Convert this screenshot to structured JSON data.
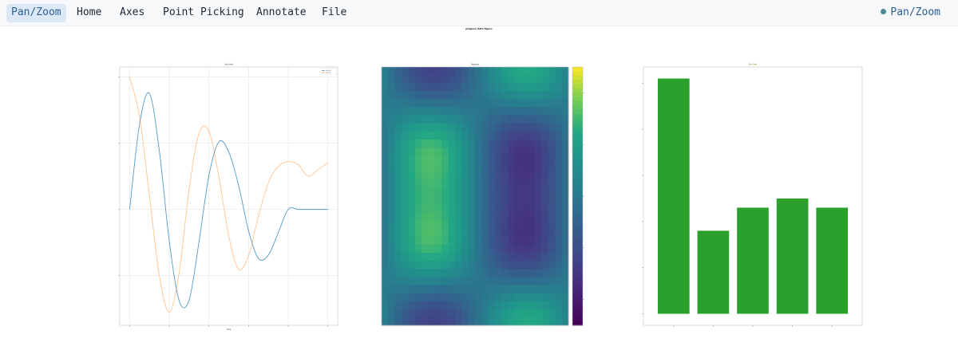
{
  "toolbar": {
    "buttons": [
      {
        "label": "Pan/Zoom",
        "active": true
      },
      {
        "label": "Home",
        "active": false
      },
      {
        "label": "Axes",
        "active": false
      },
      {
        "label": "Point Picking",
        "active": false
      },
      {
        "label": "Annotate",
        "active": false
      },
      {
        "label": "File",
        "active": false
      }
    ],
    "mode_label": "Pan/Zoom"
  },
  "figure": {
    "suptitle": "pidgeon data figure"
  },
  "chart_data": [
    {
      "type": "line",
      "title": "Line chart",
      "xlabel": "Time",
      "ylabel": "",
      "grid": true,
      "legend_placement": "top-right",
      "legend": [
        "Series A",
        "Series B"
      ],
      "xlim": [
        -0.5,
        10.5
      ],
      "ylim": [
        -1.75,
        2.15
      ],
      "series": [
        {
          "name": "Series A",
          "color": "#1f77b4",
          "x": [
            0,
            0.5,
            1,
            1.5,
            2,
            2.5,
            3,
            3.5,
            4,
            4.5,
            5,
            5.5,
            6,
            6.5,
            7,
            7.5,
            8,
            8.5,
            9,
            9.5,
            10
          ],
          "values": [
            0.0,
            1.29,
            1.75,
            0.88,
            -0.48,
            -1.38,
            -1.37,
            -0.49,
            0.51,
            1.02,
            0.87,
            0.36,
            -0.32,
            -0.74,
            -0.69,
            -0.35,
            0.0,
            0.0,
            0.0,
            0.0,
            0.0
          ]
        },
        {
          "name": "Series B",
          "color": "#ff7f0e",
          "x": [
            0,
            0.5,
            1,
            1.5,
            2,
            2.5,
            3,
            3.5,
            4,
            4.5,
            5,
            5.5,
            6,
            6.5,
            7,
            7.5,
            8,
            8.5,
            9,
            9.5,
            10
          ],
          "values": [
            2.0,
            1.4,
            0.2,
            -1.0,
            -1.55,
            -0.95,
            0.3,
            1.15,
            1.18,
            0.5,
            -0.4,
            -0.9,
            -0.7,
            -0.1,
            0.4,
            0.65,
            0.72,
            0.68,
            0.5,
            0.6,
            0.7
          ]
        }
      ]
    },
    {
      "type": "heatmap",
      "title": "Heatmap",
      "colormap": "viridis",
      "colorbar": true,
      "rows": 32,
      "cols": 28,
      "vmin": -1,
      "vmax": 1
    },
    {
      "type": "bar",
      "title": "Bar chart",
      "categories": [
        "A",
        "B",
        "C",
        "D",
        "E"
      ],
      "values": [
        5.1,
        1.8,
        2.3,
        2.5,
        2.3
      ],
      "ylim": [
        -0.25,
        5.35
      ],
      "color": "#2ca02c"
    }
  ]
}
